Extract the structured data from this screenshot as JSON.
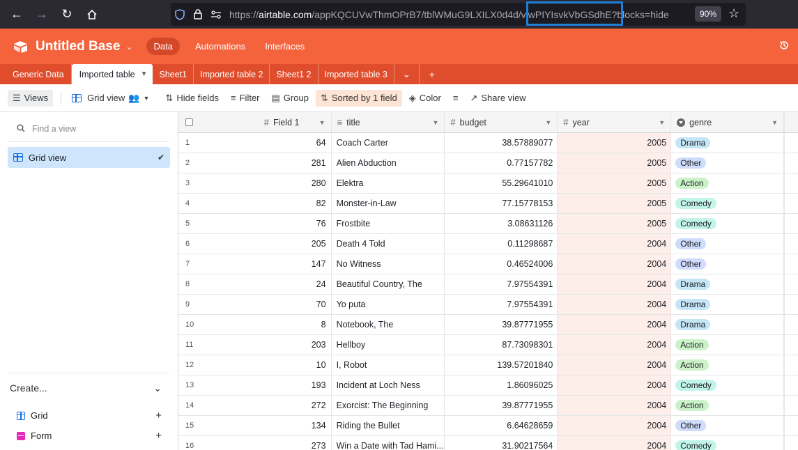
{
  "browser": {
    "url_prefix": "https://",
    "url_host": "airtable.com",
    "url_path": "/appKQCUVwThmOPrB7/tblWMuG9LXILX0d4d/viwPIYIsvkVbGSdhE?blocks=hide",
    "zoom": "90%"
  },
  "app": {
    "base_title": "Untitled Base",
    "top_tabs": [
      "Data",
      "Automations",
      "Interfaces"
    ]
  },
  "table_tabs": [
    "Generic Data",
    "Imported table",
    "Sheet1",
    "Imported table 2",
    "Sheet1 2",
    "Imported table 3"
  ],
  "toolbar": {
    "views": "Views",
    "grid_view": "Grid view",
    "hide_fields": "Hide fields",
    "filter": "Filter",
    "group": "Group",
    "sorted": "Sorted by 1 field",
    "color": "Color",
    "share": "Share view"
  },
  "sidebar": {
    "find_placeholder": "Find a view",
    "active_view": "Grid view",
    "create_label": "Create...",
    "create_items": [
      "Grid",
      "Form"
    ]
  },
  "columns": {
    "field1": "Field 1",
    "title": "title",
    "budget": "budget",
    "year": "year",
    "genre": "genre"
  },
  "genre_colors": {
    "Drama": "#c5e6f7",
    "Other": "#cfdcfb",
    "Action": "#cbf2c8",
    "Comedy": "#c2f5e9"
  },
  "rows": [
    {
      "n": "1",
      "f1": "64",
      "title": "Coach Carter",
      "budget": "38.57889077",
      "year": "2005",
      "genre": "Drama"
    },
    {
      "n": "2",
      "f1": "281",
      "title": "Alien Abduction",
      "budget": "0.77157782",
      "year": "2005",
      "genre": "Other"
    },
    {
      "n": "3",
      "f1": "280",
      "title": "Elektra",
      "budget": "55.29641010",
      "year": "2005",
      "genre": "Action"
    },
    {
      "n": "4",
      "f1": "82",
      "title": "Monster-in-Law",
      "budget": "77.15778153",
      "year": "2005",
      "genre": "Comedy"
    },
    {
      "n": "5",
      "f1": "76",
      "title": "Frostbite",
      "budget": "3.08631126",
      "year": "2005",
      "genre": "Comedy"
    },
    {
      "n": "6",
      "f1": "205",
      "title": "Death 4 Told",
      "budget": "0.11298687",
      "year": "2004",
      "genre": "Other"
    },
    {
      "n": "7",
      "f1": "147",
      "title": "No Witness",
      "budget": "0.46524006",
      "year": "2004",
      "genre": "Other"
    },
    {
      "n": "8",
      "f1": "24",
      "title": "Beautiful Country, The",
      "budget": "7.97554391",
      "year": "2004",
      "genre": "Drama"
    },
    {
      "n": "9",
      "f1": "70",
      "title": "Yo puta",
      "budget": "7.97554391",
      "year": "2004",
      "genre": "Drama"
    },
    {
      "n": "10",
      "f1": "8",
      "title": "Notebook, The",
      "budget": "39.87771955",
      "year": "2004",
      "genre": "Drama"
    },
    {
      "n": "11",
      "f1": "203",
      "title": "Hellboy",
      "budget": "87.73098301",
      "year": "2004",
      "genre": "Action"
    },
    {
      "n": "12",
      "f1": "10",
      "title": "I, Robot",
      "budget": "139.57201840",
      "year": "2004",
      "genre": "Action"
    },
    {
      "n": "13",
      "f1": "193",
      "title": "Incident at Loch Ness",
      "budget": "1.86096025",
      "year": "2004",
      "genre": "Comedy"
    },
    {
      "n": "14",
      "f1": "272",
      "title": "Exorcist: The Beginning",
      "budget": "39.87771955",
      "year": "2004",
      "genre": "Action"
    },
    {
      "n": "15",
      "f1": "134",
      "title": "Riding the Bullet",
      "budget": "6.64628659",
      "year": "2004",
      "genre": "Other"
    },
    {
      "n": "16",
      "f1": "273",
      "title": "Win a Date with Tad Hami...",
      "budget": "31.90217564",
      "year": "2004",
      "genre": "Comedy"
    }
  ]
}
